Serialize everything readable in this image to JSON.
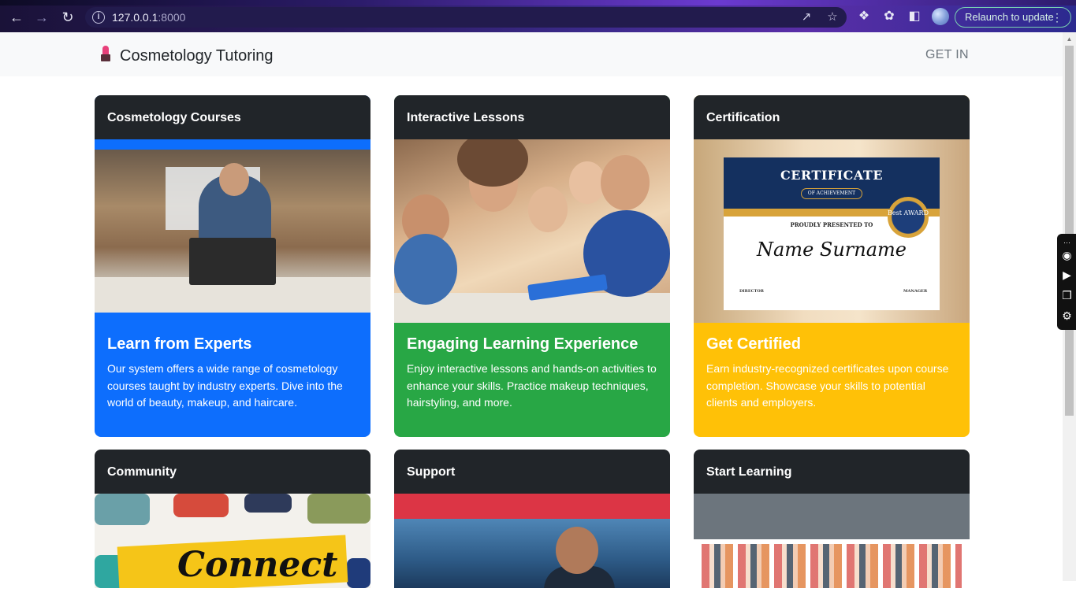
{
  "browser": {
    "url_host": "127.0.0.1",
    "url_port": ":8000",
    "relaunch_label": "Relaunch to update"
  },
  "navbar": {
    "brand": "Cosmetology Tutoring",
    "get_in": "GET IN"
  },
  "cards": [
    {
      "header": "Cosmetology Courses",
      "title": "Learn from Experts",
      "text": "Our system offers a wide range of cosmetology courses taught by industry experts. Dive into the world of beauty, makeup, and haircare.",
      "color": "#0d6efd"
    },
    {
      "header": "Interactive Lessons",
      "title": "Engaging Learning Experience",
      "text": "Enjoy interactive lessons and hands-on activities to enhance your skills. Practice makeup techniques, hairstyling, and more.",
      "color": "#28a745"
    },
    {
      "header": "Certification",
      "title": "Get Certified",
      "text": "Earn industry-recognized certificates upon course completion. Showcase your skills to potential clients and employers.",
      "color": "#ffc107"
    },
    {
      "header": "Community"
    },
    {
      "header": "Support"
    },
    {
      "header": "Start Learning"
    }
  ],
  "certificate": {
    "title": "CERTIFICATE",
    "subtitle": "OF ACHIEVEMENT",
    "presented": "PROUDLY PRESENTED TO",
    "name": "Name Surname",
    "seal": "Best AWARD",
    "director": "DIRECTOR",
    "manager": "MANAGER"
  },
  "connect_word": "Connect"
}
